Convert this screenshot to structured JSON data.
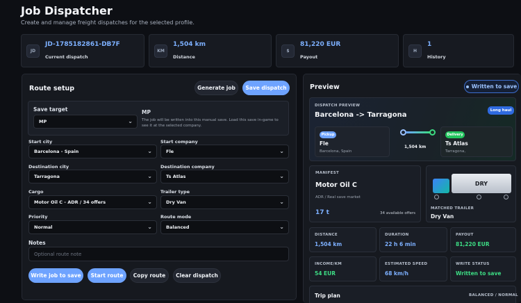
{
  "header": {
    "title": "Job Dispatcher",
    "subtitle": "Create and manage freight dispatches for the selected profile."
  },
  "stats": [
    {
      "icon": "JD",
      "value": "JD-1785182861-DB7F",
      "label": "Current dispatch"
    },
    {
      "icon": "KM",
      "value": "1,504 km",
      "label": "Distance"
    },
    {
      "icon": "$",
      "value": "81,220 EUR",
      "label": "Payout"
    },
    {
      "icon": "H",
      "value": "1",
      "label": "History"
    }
  ],
  "route_setup": {
    "title": "Route setup",
    "generate_label": "Generate job",
    "save_label": "Save dispatch",
    "save_target_label": "Save target",
    "save_target_value": "MP",
    "save_info_title": "MP",
    "save_info_text": "The job will be written into this manual save. Load this save in-game to see it at the selected company.",
    "start_city_label": "Start city",
    "start_city_value": "Barcelona - Spain",
    "start_company_label": "Start company",
    "start_company_value": "Fle",
    "dest_city_label": "Destination city",
    "dest_city_value": "Tarragona",
    "dest_company_label": "Destination company",
    "dest_company_value": "Ts Atlas",
    "cargo_label": "Cargo",
    "cargo_value": "Motor Oil C - ADR / 34 offers",
    "trailer_label": "Trailer type",
    "trailer_value": "Dry Van",
    "priority_label": "Priority",
    "priority_value": "Normal",
    "route_mode_label": "Route mode",
    "route_mode_value": "Balanced",
    "notes_label": "Notes",
    "notes_placeholder": "Optional route note",
    "write_label": "Write job to save",
    "start_route_label": "Start route",
    "copy_label": "Copy route",
    "clear_label": "Clear dispatch"
  },
  "preview": {
    "title": "Preview",
    "status_badge": "Written to save",
    "dispatch_label": "DISPATCH PREVIEW",
    "route_title": "Barcelona -> Tarragona",
    "haul_badge": "Long haul",
    "pickup_tag": "Pickup",
    "pickup_company": "Fle",
    "pickup_city": "Barcelona, Spain",
    "distance": "1,504 km",
    "delivery_tag": "Delivery",
    "delivery_company": "Ts Atlas",
    "delivery_city": "Tarragona,",
    "manifest_label": "MANIFEST",
    "cargo_name": "Motor Oil C",
    "cargo_desc": "ADR / Real save market",
    "weight": "17 t",
    "offers": "34 available offers",
    "trailer_text": "DRY",
    "matched_label": "MATCHED TRAILER",
    "matched_value": "Dry Van",
    "metrics": [
      {
        "label": "DISTANCE",
        "value": "1,504 km",
        "color": "#7db0ff"
      },
      {
        "label": "DURATION",
        "value": "22 h 6 min",
        "color": "#7db0ff"
      },
      {
        "label": "PAYOUT",
        "value": "81,220 EUR",
        "color": "#3ddc84"
      },
      {
        "label": "INCOME/KM",
        "value": "54 EUR",
        "color": "#3ddc84"
      },
      {
        "label": "ESTIMATED SPEED",
        "value": "68 km/h",
        "color": "#7db0ff"
      },
      {
        "label": "WRITE STATUS",
        "value": "Written to save",
        "color": "#3ddc84"
      }
    ],
    "trip_plan_label": "Trip plan",
    "trip_plan_mode": "BALANCED / NORMAL"
  }
}
